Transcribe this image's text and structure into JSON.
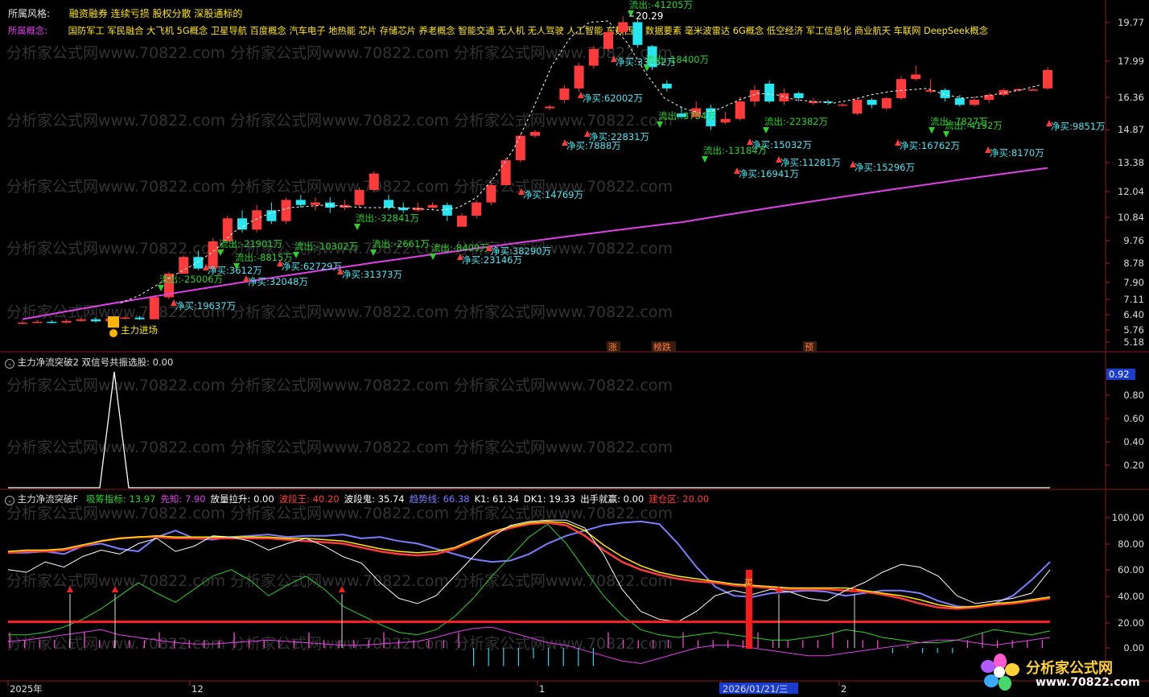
{
  "header": {
    "style_label": "所属风格:",
    "style_value": "融资融券 连续亏损 股权分散 深股通标的",
    "concept_label": "所属概念:",
    "concept_value": "国防军工 军民融合 大飞机 5G概念 卫星导航 百度概念 汽车电子 地热能 芯片 存储芯片 养老概念 智能交通 无人机 无人驾驶 人工智能 东数西算 数据要素 毫米波雷达 6G概念 低空经济 军工信息化 商业航天 车联网 DeepSeek概念"
  },
  "watermark": "分析家公式网www.70822.com",
  "colors": {
    "up": "#ff3b3b",
    "down": "#27e6f0",
    "ma": "#e040e8",
    "green": "#2cd32c",
    "cyan": "#4ee6f0",
    "yellow": "#ffe600",
    "white": "#ffffff"
  },
  "main_price_axis": [
    "19.77",
    "17.99",
    "16.36",
    "14.87",
    "13.38",
    "12.04",
    "10.84",
    "9.76",
    "8.78",
    "7.90",
    "7.11",
    "6.40",
    "5.76",
    "5.18"
  ],
  "peak_label": "20.29",
  "event_tags": [
    "涨",
    "榜跌",
    "预"
  ],
  "signal_labels": [
    {
      "text": "主力进场",
      "kind": "y"
    },
    {
      "text": "净买:19637万",
      "kind": "c"
    },
    {
      "text": "流出:-25006万",
      "kind": "g"
    },
    {
      "text": "流出:-21901万",
      "kind": "g"
    },
    {
      "text": "净买:3612万",
      "kind": "c"
    },
    {
      "text": "流出:-8815万",
      "kind": "g"
    },
    {
      "text": "净买:32048万",
      "kind": "c"
    },
    {
      "text": "流出:-10302万",
      "kind": "g"
    },
    {
      "text": "净买:62729万",
      "kind": "c"
    },
    {
      "text": "净买:31373万",
      "kind": "c"
    },
    {
      "text": "流出:-32841万",
      "kind": "g"
    },
    {
      "text": "流出:-2661万",
      "kind": "g"
    },
    {
      "text": "流出:-8409万",
      "kind": "g"
    },
    {
      "text": "净买:23146万",
      "kind": "c"
    },
    {
      "text": "净买:38290万",
      "kind": "c"
    },
    {
      "text": "净买:14769万",
      "kind": "c"
    },
    {
      "text": "净买:7888万",
      "kind": "c"
    },
    {
      "text": "净买:22831万",
      "kind": "c"
    },
    {
      "text": "净买:62002万",
      "kind": "c"
    },
    {
      "text": "净买:33952万",
      "kind": "c"
    },
    {
      "text": "流出:-41205万",
      "kind": "g"
    },
    {
      "text": "流出:-18400万",
      "kind": "g"
    },
    {
      "text": "流出:-3754万",
      "kind": "g"
    },
    {
      "text": "流出:-13184万",
      "kind": "g"
    },
    {
      "text": "净买:16941万",
      "kind": "c"
    },
    {
      "text": "净买:15032万",
      "kind": "c"
    },
    {
      "text": "流出:-22382万",
      "kind": "g"
    },
    {
      "text": "净买:11281万",
      "kind": "c"
    },
    {
      "text": "净买:15296万",
      "kind": "c"
    },
    {
      "text": "净买:16762万",
      "kind": "c"
    },
    {
      "text": "流出:-7827万",
      "kind": "g"
    },
    {
      "text": "流出:-4192万",
      "kind": "g"
    },
    {
      "text": "净买:8170万",
      "kind": "c"
    },
    {
      "text": "净买:9851万",
      "kind": "c"
    }
  ],
  "panel2": {
    "title": "主力净流突破2 双信号共振选股: 0.00",
    "axis": [
      "0.92",
      "0.80",
      "0.60",
      "0.40",
      "0.20"
    ]
  },
  "panel3": {
    "name": "主力净流突破F",
    "items": [
      {
        "label": "吸筹指标:",
        "value": "13.97",
        "color": "#2cd32c"
      },
      {
        "label": "先知:",
        "value": "7.90",
        "color": "#e040e8"
      },
      {
        "label": "放量拉升:",
        "value": "0.00",
        "color": "#ffffff"
      },
      {
        "label": "波段王:",
        "value": "40.20",
        "color": "#ff3b3b"
      },
      {
        "label": "波段鬼:",
        "value": "35.74",
        "color": "#ffffff"
      },
      {
        "label": "趋势线:",
        "value": "66.38",
        "color": "#7d7dff"
      },
      {
        "label": "K1:",
        "value": "61.34",
        "color": "#ffffff"
      },
      {
        "label": "DK1:",
        "value": "19.33",
        "color": "#ffffff"
      },
      {
        "label": "出手就赢:",
        "value": "0.00",
        "color": "#ffffff"
      },
      {
        "label": "建仓区:",
        "value": "20.00",
        "color": "#ff3b3b"
      }
    ],
    "axis": [
      "100.00",
      "80.00",
      "60.00",
      "40.00",
      "20.00",
      "0.00"
    ],
    "buy_tag": "买"
  },
  "time_axis": [
    "2025年",
    "12",
    "1",
    "2026/01/21/三",
    "2"
  ],
  "logo": {
    "text": "分析家公式网",
    "url": "www.70822.com"
  }
}
